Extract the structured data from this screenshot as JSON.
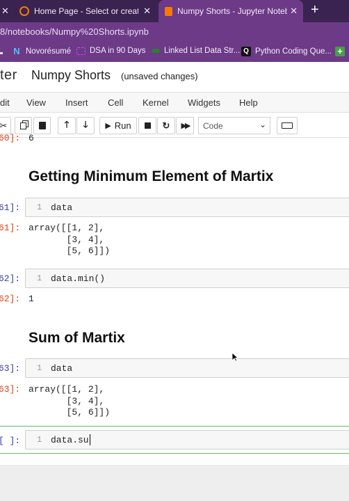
{
  "browser": {
    "tabs": [
      {
        "title": "Home Page - Select or create a n",
        "active": false,
        "icon": "jupyter-icon",
        "close": "✕"
      },
      {
        "title": "Numpy Shorts - Jupyter Noteboo",
        "active": true,
        "icon": "notebook-icon",
        "close": "✕"
      }
    ],
    "left_close": "✕",
    "new_tab": "+",
    "address": "8/notebooks/Numpy%20Shorts.ipynb",
    "bookmarks": [
      {
        "label": "",
        "icon": "bookmark-partial-icon"
      },
      {
        "label": "Novorésumé",
        "icon": "novoresume-icon"
      },
      {
        "label": "DSA in 90 Days",
        "icon": "dsa-icon"
      },
      {
        "label": "Linked List Data Str...",
        "icon": "linked-list-icon"
      },
      {
        "label": "Python Coding Que...",
        "icon": "python-q-icon",
        "glyph": "Q"
      },
      {
        "label": "",
        "icon": "plus-bookmark-icon",
        "glyph": "+"
      }
    ]
  },
  "jupyter": {
    "logo_text": "ter",
    "title": "Numpy Shorts",
    "status": "(unsaved changes)",
    "menu": [
      "dit",
      "View",
      "Insert",
      "Cell",
      "Kernel",
      "Widgets",
      "Help"
    ],
    "toolbar": {
      "run_label": "Run",
      "cell_type": "Code"
    }
  },
  "cells": {
    "top_partial": {
      "prompt": "60]:",
      "output": "6"
    },
    "heading1": "Getting Minimum Element of Martix",
    "c61": {
      "in_prompt": "61]:",
      "line": "1",
      "code": "data",
      "out_prompt": "61]:",
      "output": "array([[1, 2],\n       [3, 4],\n       [5, 6]])"
    },
    "c62": {
      "in_prompt": "62]:",
      "line": "1",
      "code": "data.min()",
      "out_prompt": "62]:",
      "output": "1"
    },
    "heading2": "Sum of Martix",
    "c63": {
      "in_prompt": "63]:",
      "line": "1",
      "code": "data",
      "out_prompt": "63]:",
      "output": "array([[1, 2],\n       [3, 4],\n       [5, 6]])"
    },
    "c_new": {
      "in_prompt": "[ ]:",
      "line": "1",
      "code": "data.su"
    }
  },
  "colors": {
    "tab_bar": "#3a2350",
    "chrome": "#6c3a86",
    "in_prompt": "#303f9f",
    "out_prompt": "#d84315",
    "selected_cell_border": "#66bb6a"
  }
}
